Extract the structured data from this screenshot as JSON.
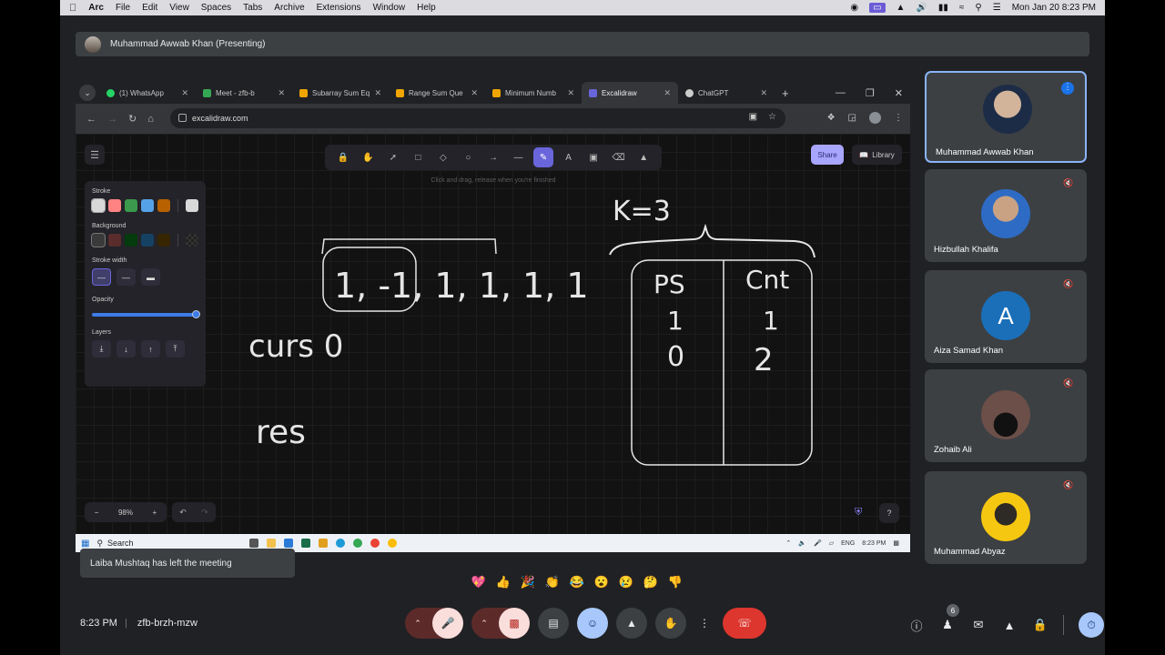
{
  "mac_menu": {
    "app": "Arc",
    "items": [
      "File",
      "Edit",
      "View",
      "Spaces",
      "Tabs",
      "Archive",
      "Extensions",
      "Window",
      "Help"
    ],
    "clock": "Mon Jan 20  8:23 PM"
  },
  "presenter": {
    "text": "Muhammad Awwab Khan (Presenting)"
  },
  "browser": {
    "tabs": [
      {
        "label": "(1) WhatsApp",
        "color": "#25d366"
      },
      {
        "label": "Meet - zfb-b",
        "color": "#34a853"
      },
      {
        "label": "Subarray Sum Eq",
        "color": "#f0a500"
      },
      {
        "label": "Range Sum Que",
        "color": "#f0a500"
      },
      {
        "label": "Minimum Numb",
        "color": "#f0a500"
      },
      {
        "label": "Excalidraw",
        "color": "#6965db"
      },
      {
        "label": "ChatGPT",
        "color": "#cccccc"
      }
    ],
    "url": "excalidraw.com"
  },
  "excalidraw": {
    "hint": "Click and drag, release when you're finished",
    "share": "Share",
    "library": "Library",
    "props": {
      "stroke": "Stroke",
      "background": "Background",
      "stroke_width": "Stroke width",
      "opacity": "Opacity",
      "opacity_value": 1.0,
      "layers": "Layers",
      "stroke_colors": [
        "#d8d8d8",
        "#ff8383",
        "#3a994c",
        "#56a2e8",
        "#b76100"
      ],
      "stroke_current": "#d9d9d9",
      "bg_colors": [
        "#3a3a3a",
        "#5b2c2c",
        "#043b0c",
        "#154163",
        "#362500"
      ]
    },
    "zoom": "98%",
    "drawing": {
      "k": "K=3",
      "array": "1, -1, 1, 1, 1, 1",
      "curs": "curs 0",
      "res": "res",
      "col_ps": "PS",
      "col_cnt": "Cnt",
      "ps_vals": [
        "1",
        "0"
      ],
      "cnt_vals": [
        "1",
        "2"
      ]
    }
  },
  "taskbar": {
    "search": "Search",
    "lang": "ENG",
    "time": "8:23 PM"
  },
  "toast": "Laiba Mushtaq has left the meeting",
  "participants": [
    {
      "name": "Muhammad Awwab Khan",
      "speaking": true
    },
    {
      "name": "Hizbullah Khalifa"
    },
    {
      "name": "Aiza Samad Khan",
      "initial": "A"
    },
    {
      "name": "Zohaib Ali"
    },
    {
      "name": "Muhammad Abyaz"
    }
  ],
  "reactions": [
    "💖",
    "👍",
    "🎉",
    "👏",
    "😂",
    "😮",
    "😢",
    "🤔",
    "👎"
  ],
  "meeting": {
    "time": "8:23 PM",
    "code": "zfb-brzh-mzw"
  },
  "people_count": "6"
}
